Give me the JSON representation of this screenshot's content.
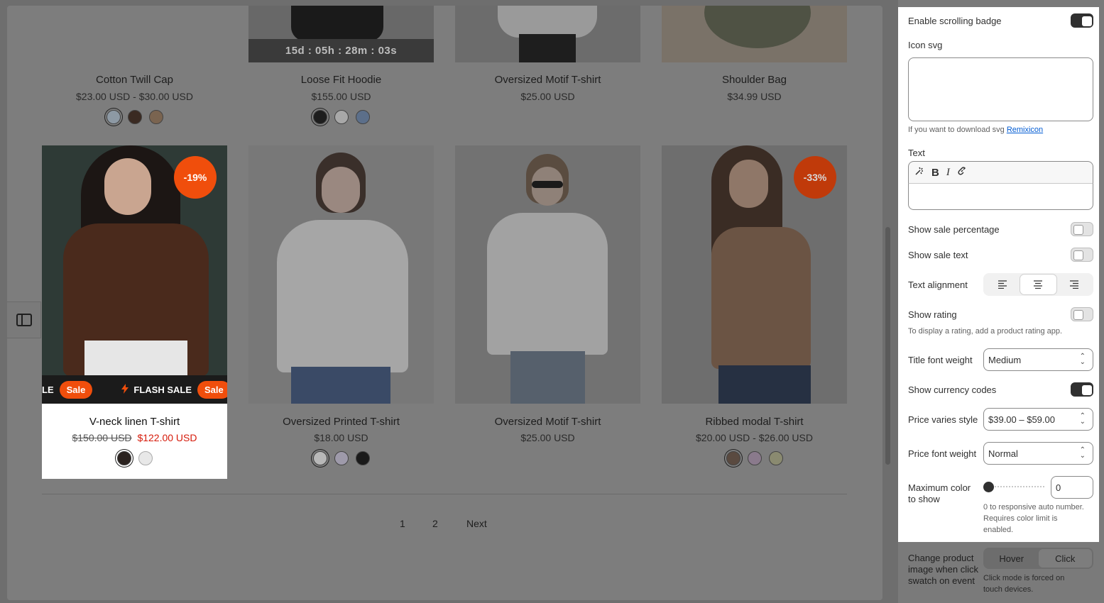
{
  "products_top": [
    {
      "title": "Cotton Twill Cap",
      "price": "$23.00 USD - $30.00 USD",
      "swatches": [
        "#8d99a4",
        "#3a2a22",
        "#7a6450"
      ]
    },
    {
      "title": "Loose Fit Hoodie",
      "price": "$155.00 USD",
      "timer": "15d : 05h : 28m : 03s",
      "swatches": [
        "#1d1d1d",
        "#a8a8a8",
        "#5c6f8a"
      ]
    },
    {
      "title": "Oversized Motif T-shirt",
      "price": "$25.00 USD",
      "swatches": []
    },
    {
      "title": "Shoulder Bag",
      "price": "$34.99 USD",
      "swatches": []
    }
  ],
  "products_bottom": [
    {
      "title": "V-neck linen T-shirt",
      "compare_price": "$150.00 USD",
      "sale_price": "$122.00 USD",
      "badge": "-19%",
      "marquee": {
        "fragment": "LE",
        "sale_label": "Sale",
        "flash_label": "FLASH SALE"
      },
      "swatches": [
        "#2b2320",
        "#e8e8e8"
      ]
    },
    {
      "title": "Oversized Printed T-shirt",
      "price": "$18.00 USD",
      "swatches": [
        "#b8b8b8",
        "#9e9aaa",
        "#1a1a1a"
      ]
    },
    {
      "title": "Oversized Motif T-shirt",
      "price": "$25.00 USD",
      "swatches": []
    },
    {
      "title": "Ribbed modal T-shirt",
      "price": "$20.00 USD - $26.00 USD",
      "badge": "-33%",
      "swatches": [
        "#5a4a40",
        "#8a7a8c",
        "#8a8a70"
      ]
    }
  ],
  "pagination": {
    "page1": "1",
    "page2": "2",
    "next": "Next"
  },
  "panel": {
    "enable_scrolling_badge": {
      "label": "Enable scrolling badge",
      "on": true
    },
    "icon_svg": {
      "label": "Icon svg",
      "help_prefix": "If you want to download svg",
      "help_link": "Remixicon"
    },
    "text": {
      "label": "Text"
    },
    "show_sale_percentage": {
      "label": "Show sale percentage",
      "on": false
    },
    "show_sale_text": {
      "label": "Show sale text",
      "on": false
    },
    "text_alignment": {
      "label": "Text alignment",
      "selected": "center"
    },
    "show_rating": {
      "label": "Show rating",
      "on": false,
      "help": "To display a rating, add a product rating app."
    },
    "title_font_weight": {
      "label": "Title font weight",
      "value": "Medium"
    },
    "show_currency_codes": {
      "label": "Show currency codes",
      "on": true
    },
    "price_varies_style": {
      "label": "Price varies style",
      "value": "$39.00 – $59.00"
    },
    "price_font_weight": {
      "label": "Price font weight",
      "value": "Normal"
    },
    "max_color": {
      "label_line1": "Maximum color",
      "label_line2": "to show",
      "value": "0",
      "help_line1": "0 to responsive auto number.",
      "help_line2": "Requires color limit is",
      "help_line3": "enabled."
    },
    "change_image": {
      "label_line1": "Change product",
      "label_line2": "image when click",
      "label_line3": "swatch on event",
      "options": [
        "Hover",
        "Click"
      ],
      "selected": "Click",
      "help_line1": "Click mode is forced on",
      "help_line2": "touch devices."
    }
  }
}
